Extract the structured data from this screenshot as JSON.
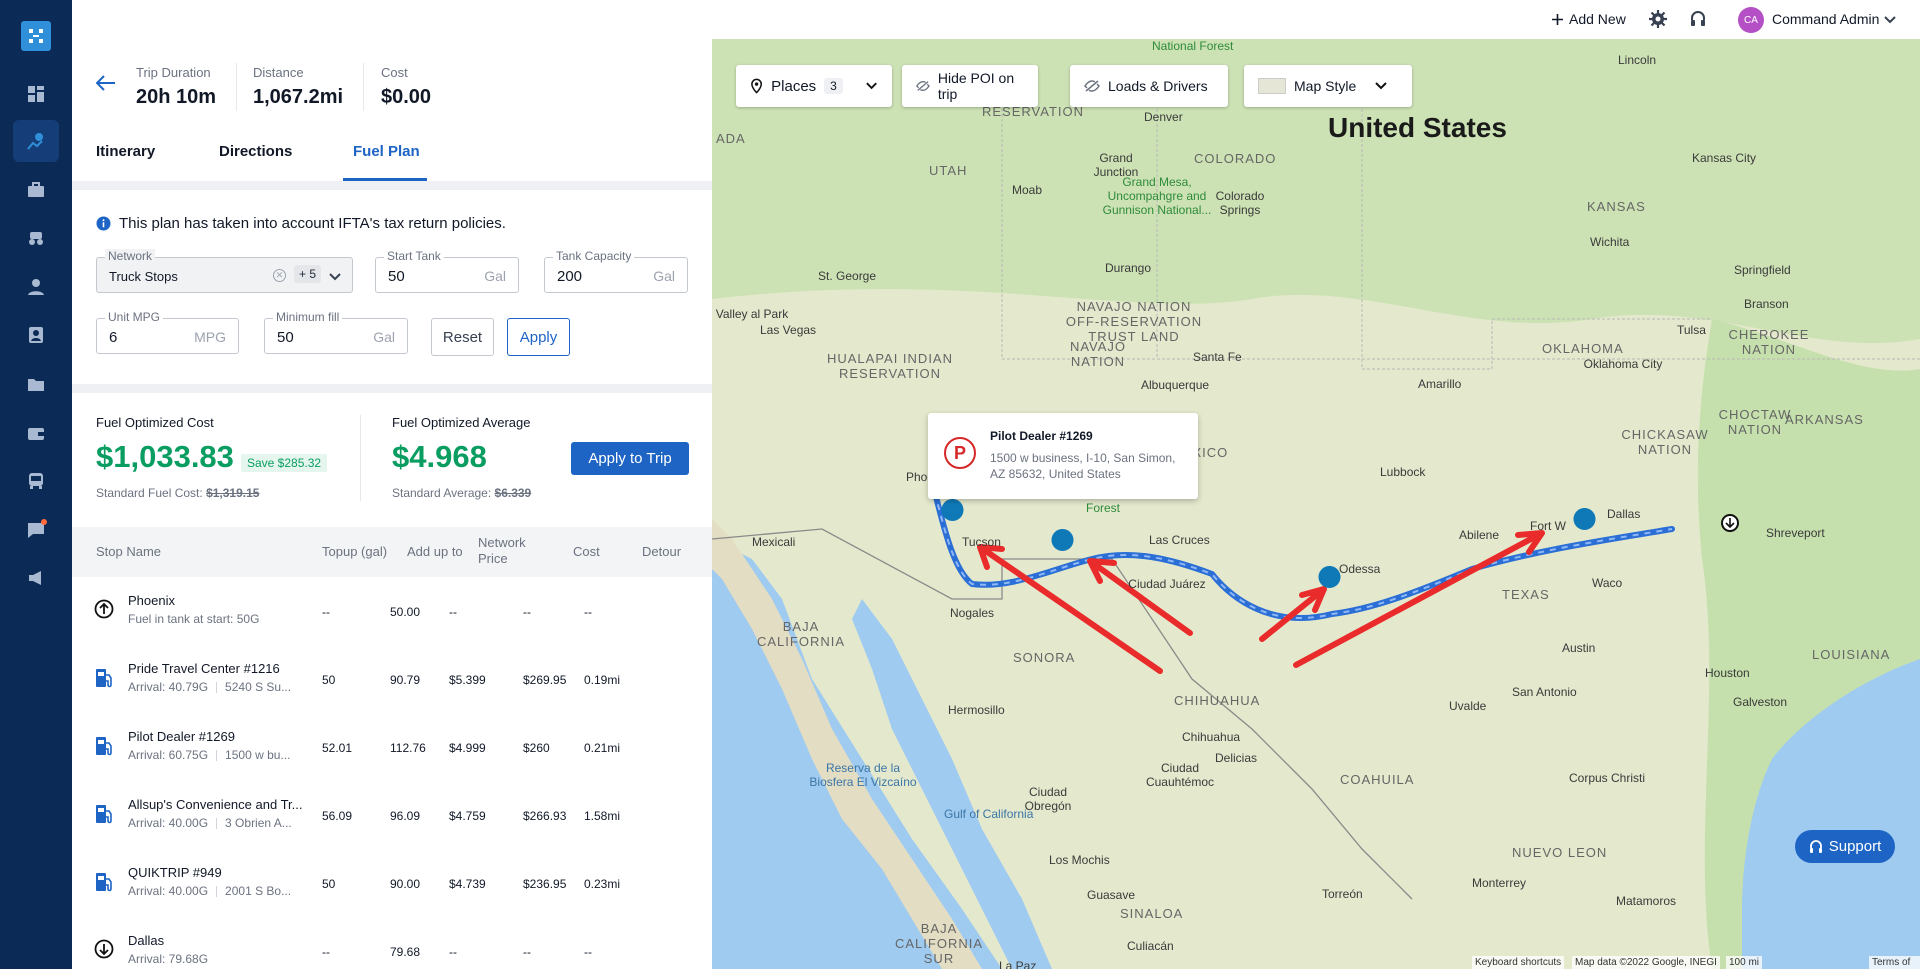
{
  "topbar": {
    "add_new": "Add New",
    "user_initials": "CA",
    "user_name": "Command Admin"
  },
  "trip": {
    "duration_label": "Trip Duration",
    "duration": "20h 10m",
    "distance_label": "Distance",
    "distance": "1,067.2mi",
    "cost_label": "Cost",
    "cost": "$0.00"
  },
  "tabs": [
    "Itinerary",
    "Directions",
    "Fuel Plan"
  ],
  "info_text": "This plan has taken into account IFTA's tax return policies.",
  "filters": {
    "network": {
      "label": "Network",
      "value": "Truck Stops",
      "more": "+ 5"
    },
    "start_tank": {
      "label": "Start Tank",
      "value": "50",
      "unit": "Gal"
    },
    "tank_capacity": {
      "label": "Tank Capacity",
      "value": "200",
      "unit": "Gal"
    },
    "unit_mpg": {
      "label": "Unit MPG",
      "value": "6",
      "unit": "MPG"
    },
    "minimum_fill": {
      "label": "Minimum fill",
      "value": "50",
      "unit": "Gal"
    },
    "reset": "Reset",
    "apply": "Apply"
  },
  "summary": {
    "cost_label": "Fuel Optimized Cost",
    "cost": "$1,033.83",
    "save": "Save $285.32",
    "std_cost_label": "Standard Fuel Cost:",
    "std_cost": "$1,319.15",
    "avg_label": "Fuel Optimized Average",
    "avg": "$4.968",
    "std_avg_label": "Standard Average:",
    "std_avg": "$6.339",
    "apply_to_trip": "Apply to Trip"
  },
  "table": {
    "headers": [
      "Stop Name",
      "Topup (gal)",
      "Add up to",
      "Network Price",
      "Cost",
      "Detour"
    ],
    "rows": [
      {
        "icon": "start-icon",
        "name": "Phoenix",
        "sub1": "Fuel in tank at start: 50G",
        "sub2": "",
        "topup": "--",
        "addup": "50.00",
        "price": "--",
        "cost": "--",
        "detour": "--"
      },
      {
        "icon": "fuel-pump-icon",
        "name": "Pride Travel Center #1216",
        "sub1": "Arrival: 40.79G",
        "sub2": "5240 S Su...",
        "topup": "50",
        "addup": "90.79",
        "price": "$5.399",
        "cost": "$269.95",
        "detour": "0.19mi"
      },
      {
        "icon": "fuel-pump-icon",
        "name": "Pilot Dealer #1269",
        "sub1": "Arrival: 60.75G",
        "sub2": "1500 w bu...",
        "topup": "52.01",
        "addup": "112.76",
        "price": "$4.999",
        "cost": "$260",
        "detour": "0.21mi"
      },
      {
        "icon": "fuel-pump-icon",
        "name": "Allsup's Convenience and Tr...",
        "sub1": "Arrival: 40.00G",
        "sub2": "3 Obrien A...",
        "topup": "56.09",
        "addup": "96.09",
        "price": "$4.759",
        "cost": "$266.93",
        "detour": "1.58mi"
      },
      {
        "icon": "fuel-pump-icon",
        "name": "QUIKTRIP #949",
        "sub1": "Arrival: 40.00G",
        "sub2": "2001 S Bo...",
        "topup": "50",
        "addup": "90.00",
        "price": "$4.739",
        "cost": "$236.95",
        "detour": "0.23mi"
      },
      {
        "icon": "end-icon",
        "name": "Dallas",
        "sub1": "Arrival: 79.68G",
        "sub2": "",
        "topup": "--",
        "addup": "79.68",
        "price": "--",
        "cost": "--",
        "detour": "--"
      }
    ]
  },
  "map": {
    "places_label": "Places",
    "places_count": "3",
    "hide_poi": "Hide POI on trip",
    "loads_drivers": "Loads & Drivers",
    "map_style": "Map Style",
    "popup": {
      "name": "Pilot Dealer #1269",
      "address": "1500 w business, I-10, San Simon, AZ 85632, United States",
      "logo": "P"
    },
    "support": "Support",
    "footer": {
      "shortcuts": "Keyboard shortcuts",
      "attribution": "Map data ©2022 Google, INEGI",
      "scale": "100 mi",
      "terms": "Terms of Use"
    },
    "labels": {
      "country": "United States",
      "states": [
        "UTAH",
        "COLORADO",
        "KANSAS",
        "NEW MEXICO",
        "TEXAS",
        "OKLAHOMA",
        "ARKANSAS",
        "LOUISIANA",
        "SONORA",
        "CHIHUAHUA",
        "COAHUILA",
        "NUEVO LEON",
        "BAJA CALIFORNIA",
        "BAJA CALIFORNIA SUR",
        "SINALOA",
        "CHICKASAW NATION",
        "CHOCTAW NATION",
        "CHEROKEE NATION",
        "NAVAJO NATION",
        "NAVAJO NATION OFF-RESERVATION TRUST LAND",
        "HUALAPAI INDIAN RESERVATION",
        "RESERVATION",
        "ADA"
      ],
      "cities": [
        "Denver",
        "Grand Junction",
        "Moab",
        "Colorado Springs",
        "Durango",
        "St. George",
        "Las Vegas",
        "Santa Fe",
        "Albuquerque",
        "Amarillo",
        "Lubbock",
        "Oklahoma City",
        "Tulsa",
        "Wichita",
        "Kansas City",
        "Springfield",
        "Branson",
        "Shreveport",
        "Dallas",
        "Fort W",
        "Abilene",
        "Odessa",
        "Waco",
        "Austin",
        "Houston",
        "San Antonio",
        "Galveston",
        "Uvalde",
        "Corpus Christi",
        "Las Cruces",
        "Ciudad Juárez",
        "Tucson",
        "Phoenix",
        "Nogales",
        "Mexicali",
        "Hermosillo",
        "Chihuahua",
        "Delicias",
        "Ciudad Cuauhtémoc",
        "Ciudad Obregón",
        "Los Mochis",
        "Guasave",
        "Culiacán",
        "Monterrey",
        "Torreón",
        "Matamoros",
        "La Paz",
        "Lincoln",
        "Valley al Park"
      ],
      "green": [
        "National Forest",
        "Grand Mesa, Uncompahgre and Gunnison National...",
        "Forest"
      ],
      "sea": [
        "Gulf of California",
        "Reserva de la Biosfera El Vizcaíno"
      ]
    }
  }
}
